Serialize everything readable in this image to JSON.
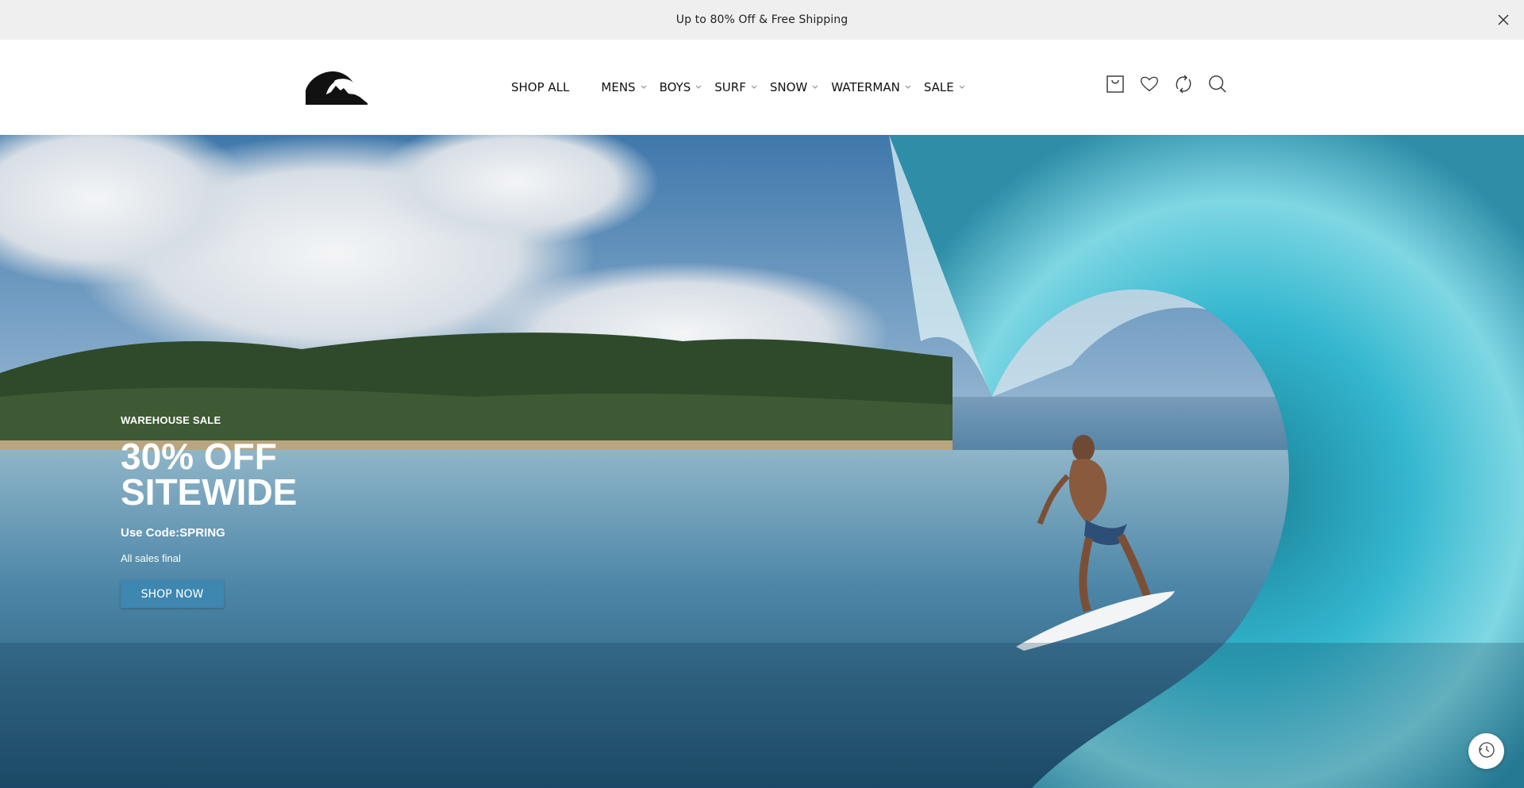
{
  "announcement": {
    "text": "Up to 80% Off & Free Shipping",
    "close_icon": "close-icon"
  },
  "header": {
    "logo_icon": "quiksilver-logo",
    "nav": [
      {
        "label": "SHOP ALL",
        "has_dropdown": false
      },
      {
        "label": "MENS",
        "has_dropdown": true
      },
      {
        "label": "BOYS",
        "has_dropdown": true
      },
      {
        "label": "SURF",
        "has_dropdown": true
      },
      {
        "label": "SNOW",
        "has_dropdown": true
      },
      {
        "label": "WATERMAN",
        "has_dropdown": true
      },
      {
        "label": "SALE",
        "has_dropdown": true
      }
    ],
    "icons": [
      "cart-icon",
      "heart-icon",
      "compare-icon",
      "search-icon"
    ]
  },
  "hero": {
    "eyebrow": "WAREHOUSE SALE",
    "headline": "30% OFF SITEWIDE",
    "code_line": "Use Code:SPRING",
    "note": "All sales final",
    "cta": "SHOP NOW",
    "cta_color": "#3d87b1"
  },
  "floating": {
    "history_icon": "history-icon"
  }
}
